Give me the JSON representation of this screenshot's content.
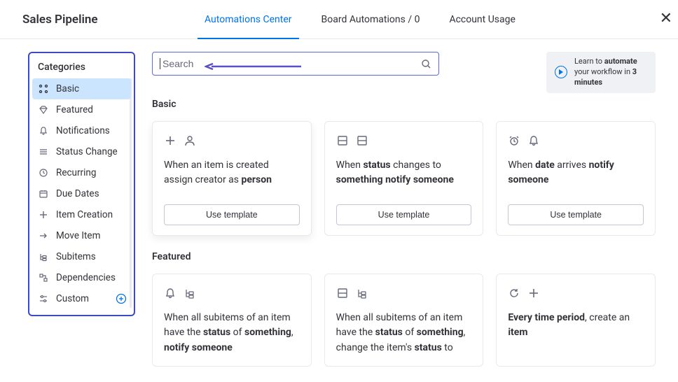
{
  "header": {
    "page_title": "Sales Pipeline",
    "tabs": {
      "automations_center": "Automations Center",
      "board_automations": "Board Automations / 0",
      "account_usage": "Account Usage"
    }
  },
  "sidebar": {
    "title": "Categories",
    "items": {
      "basic": "Basic",
      "featured": "Featured",
      "notifications": "Notifications",
      "status_change": "Status Change",
      "recurring": "Recurring",
      "due_dates": "Due Dates",
      "item_creation": "Item Creation",
      "move_item": "Move Item",
      "subitems": "Subitems",
      "dependencies": "Dependencies",
      "custom": "Custom"
    }
  },
  "search": {
    "placeholder": "Search"
  },
  "learn": {
    "prefix": "Learn to ",
    "bold1": "automate",
    "mid": " your workflow in ",
    "bold2": "3 minutes"
  },
  "sections": {
    "basic": {
      "title": "Basic",
      "use_template": "Use template",
      "cards": {
        "c1": {
          "p1": "When an item is created assign creator as ",
          "b1": "person"
        },
        "c2": {
          "p1": "When ",
          "b1": "status",
          "p2": " changes to ",
          "b2": "something",
          "p3": " ",
          "b3": "notify",
          "p4": " ",
          "b4": "someone"
        },
        "c3": {
          "p1": "When ",
          "b1": "date",
          "p2": " arrives ",
          "b2": "notify",
          "p3": " ",
          "b3": "someone"
        }
      }
    },
    "featured": {
      "title": "Featured",
      "cards": {
        "c1": {
          "p1": "When all subitems of an item have the ",
          "b1": "status",
          "p2": " of ",
          "b2": "something",
          "p3": ", ",
          "b3": "notify",
          "p4": " ",
          "b4": "someone"
        },
        "c2": {
          "p1": "When all subitems of an item have the ",
          "b1": "status",
          "p2": " of ",
          "b2": "something",
          "p3": ", change the item's ",
          "b3": "status",
          "p4": " to"
        },
        "c3": {
          "b1": "Every time period",
          "p1": ", create an ",
          "b2": "item"
        }
      }
    }
  }
}
